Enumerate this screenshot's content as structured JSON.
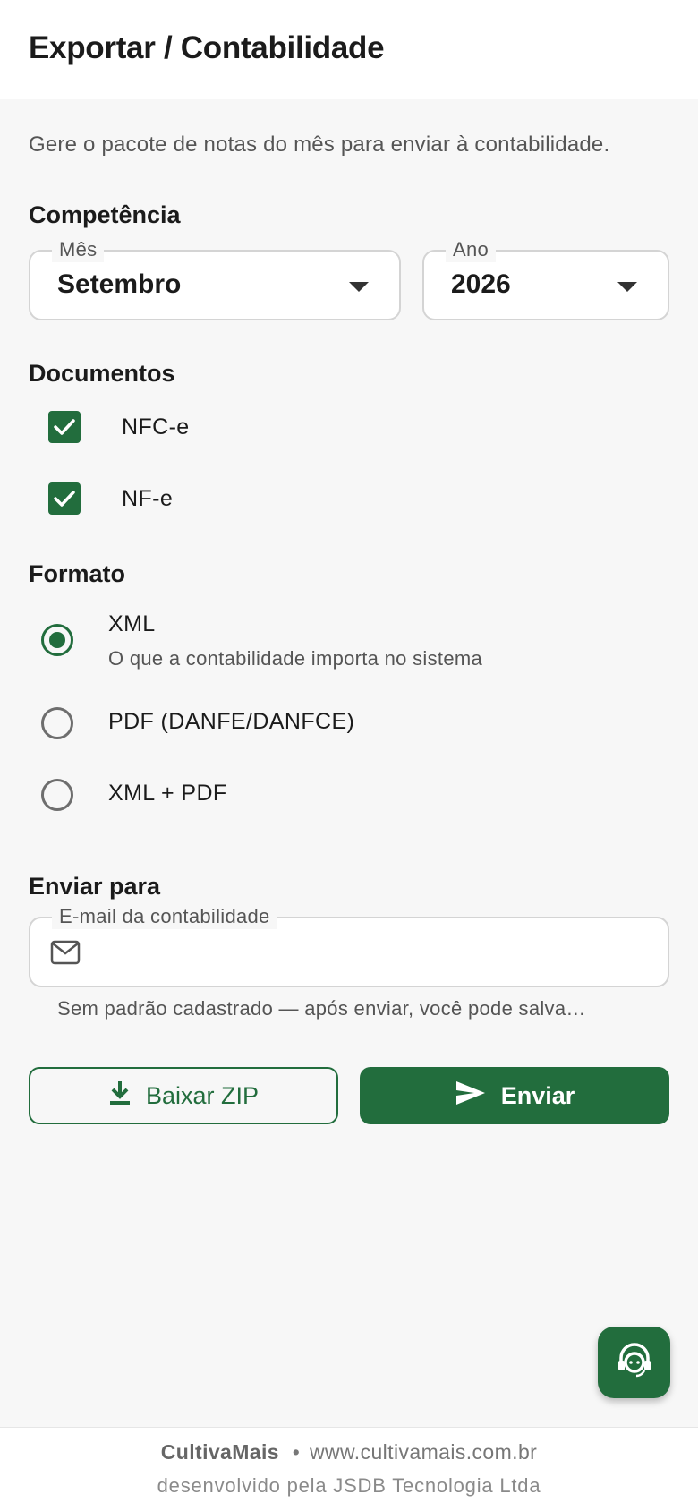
{
  "header": {
    "title": "Exportar / Contabilidade"
  },
  "description": "Gere o pacote de notas do mês para enviar à contabilidade.",
  "competencia": {
    "title": "Competência",
    "month": {
      "label": "Mês",
      "value": "Setembro"
    },
    "year": {
      "label": "Ano",
      "value": "2026"
    }
  },
  "documentos": {
    "title": "Documentos",
    "items": [
      {
        "label": "NFC-e",
        "checked": true
      },
      {
        "label": "NF-e",
        "checked": true
      }
    ]
  },
  "formato": {
    "title": "Formato",
    "options": [
      {
        "label": "XML",
        "sublabel": "O que a contabilidade importa no sistema",
        "selected": true
      },
      {
        "label": "PDF (DANFE/DANFCE)",
        "selected": false
      },
      {
        "label": "XML + PDF",
        "selected": false
      }
    ]
  },
  "enviar": {
    "title": "Enviar para",
    "email_label": "E-mail da contabilidade",
    "email_value": "",
    "helper": "Sem padrão cadastrado — após enviar, você pode salva…"
  },
  "actions": {
    "download_label": "Baixar ZIP",
    "send_label": "Enviar"
  },
  "support_fab": {
    "icon": "support-agent-icon"
  },
  "footer": {
    "brand": "CultivaMais",
    "separator": "•",
    "site": "www.cultivamais.com.br",
    "developer": "desenvolvido pela JSDB Tecnologia Ltda"
  },
  "colors": {
    "accent": "#226d3d",
    "background": "#f7f7f7"
  }
}
